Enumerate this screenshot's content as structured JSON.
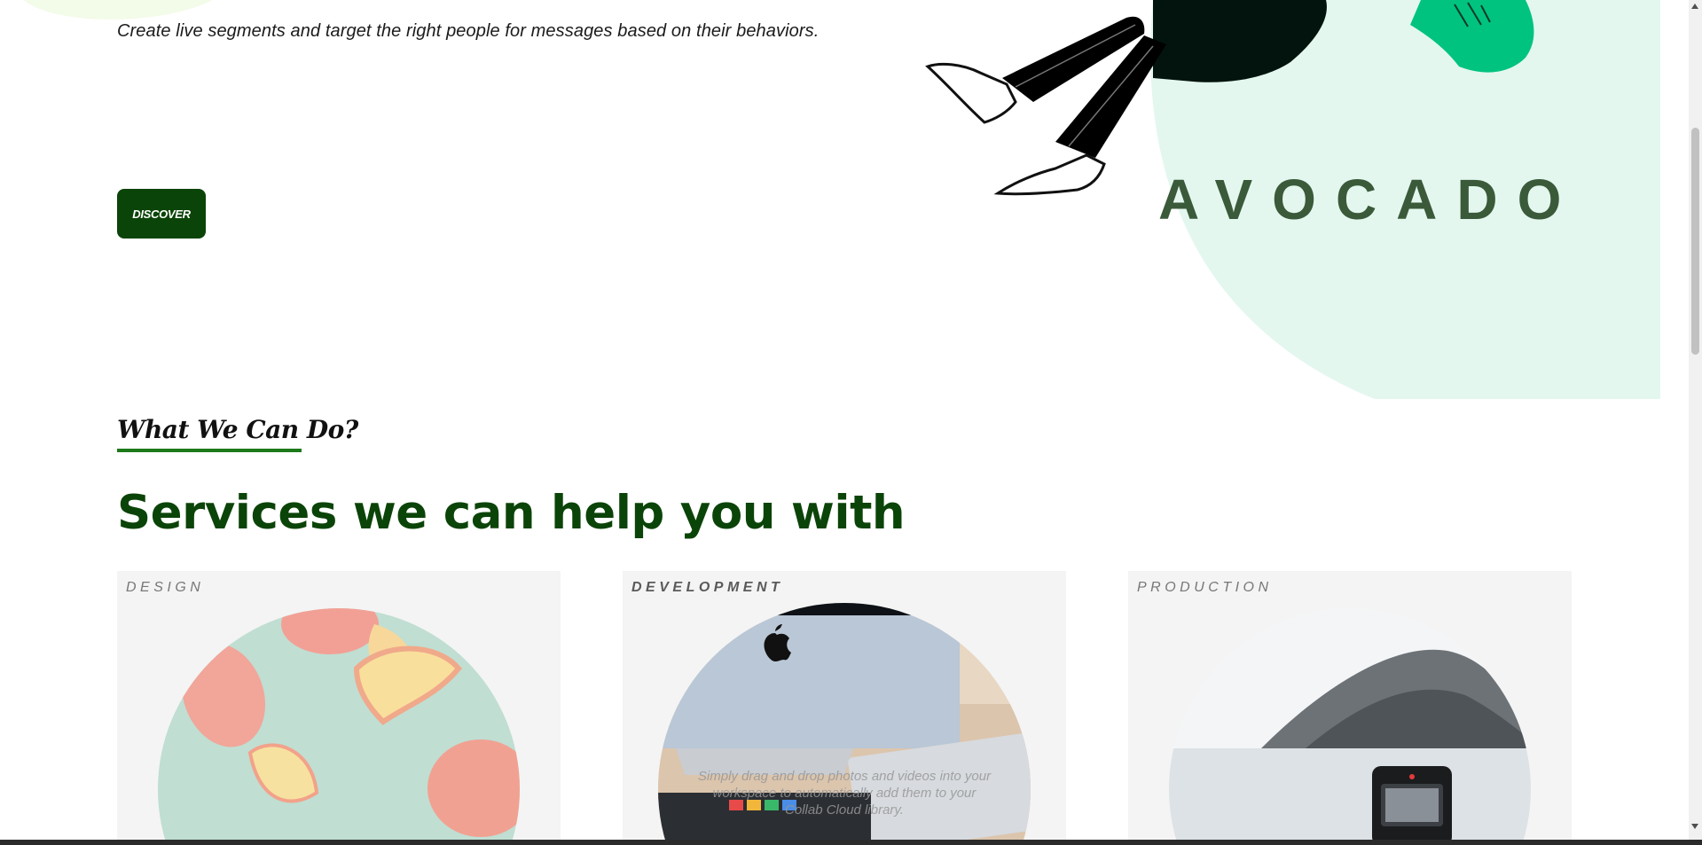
{
  "hero": {
    "subtitle": "Create live segments and target the right people for messages based on their behaviors.",
    "cta_label": "DISCOVER",
    "brand_word": "AVOCADO"
  },
  "section": {
    "kicker": "What We Can Do?",
    "title": "Services we can help you with"
  },
  "cards": [
    {
      "label": "DESIGN"
    },
    {
      "label": "DEVELOPMENT",
      "overlay_text": "Simply drag and drop photos and videos into your workspace to automatically add them to your Collab Cloud library."
    },
    {
      "label": "PRODUCTION"
    }
  ],
  "colors": {
    "brand_green": "#0b4408",
    "accent_green": "#1d7a1a",
    "mint": "#e3f7ef",
    "card_bg": "#f4f4f4"
  }
}
